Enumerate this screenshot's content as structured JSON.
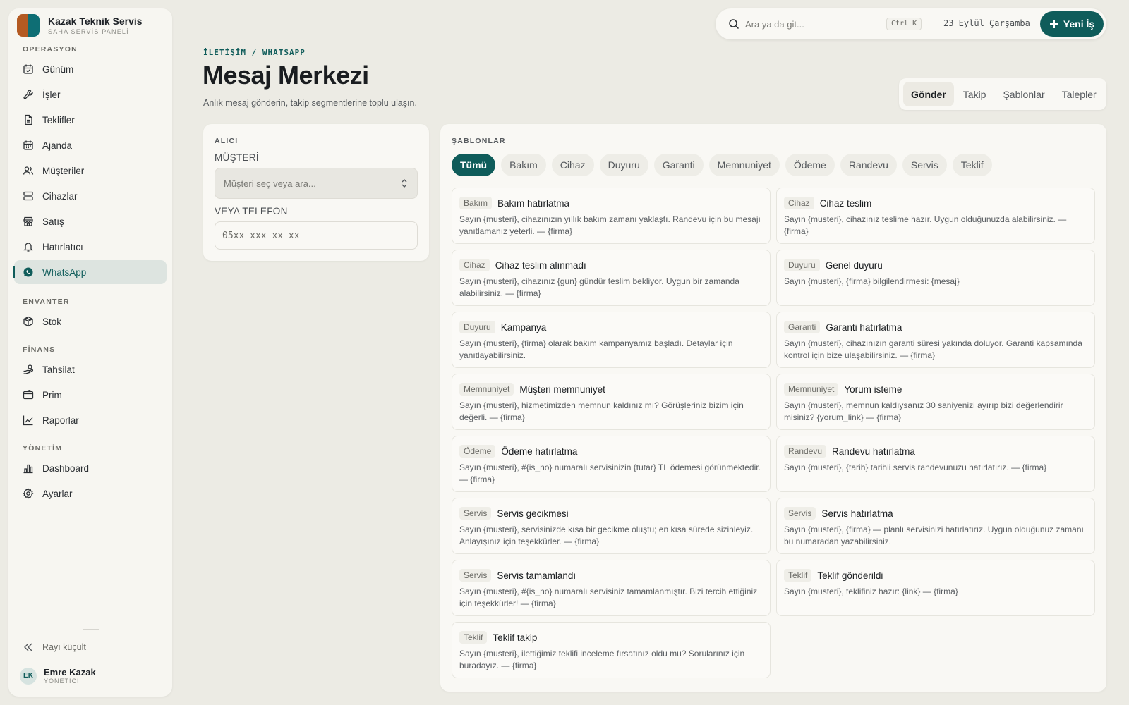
{
  "brand": {
    "title": "Kazak Teknik Servis",
    "subtitle": "SAHA SERVİS PANELİ",
    "logo_colors": [
      "#b45a22",
      "#0e6e74"
    ]
  },
  "sidebar": {
    "sections": [
      {
        "label": "OPERASYON",
        "items": [
          {
            "label": "Günüm",
            "icon": "calendar-check-icon"
          },
          {
            "label": "İşler",
            "icon": "wrench-icon"
          },
          {
            "label": "Teklifler",
            "icon": "document-icon"
          },
          {
            "label": "Ajanda",
            "icon": "calendar-icon"
          },
          {
            "label": "Müşteriler",
            "icon": "users-icon"
          },
          {
            "label": "Cihazlar",
            "icon": "server-icon"
          },
          {
            "label": "Satış",
            "icon": "store-icon"
          },
          {
            "label": "Hatırlatıcı",
            "icon": "bell-icon"
          },
          {
            "label": "WhatsApp",
            "icon": "whatsapp-icon",
            "active": true
          }
        ]
      },
      {
        "label": "ENVANTER",
        "items": [
          {
            "label": "Stok",
            "icon": "box-icon"
          }
        ]
      },
      {
        "label": "FİNANS",
        "items": [
          {
            "label": "Tahsilat",
            "icon": "hand-coins-icon"
          },
          {
            "label": "Prim",
            "icon": "wallet-icon"
          },
          {
            "label": "Raporlar",
            "icon": "trend-chart-icon"
          }
        ]
      },
      {
        "label": "YÖNETİM",
        "items": [
          {
            "label": "Dashboard",
            "icon": "bar-chart-icon"
          },
          {
            "label": "Ayarlar",
            "icon": "gear-icon"
          }
        ]
      }
    ],
    "collapse_label": "Rayı küçült",
    "user": {
      "initials": "EK",
      "name": "Emre Kazak",
      "role": "YÖNETİCİ"
    }
  },
  "topbar": {
    "search_placeholder": "Ara ya da git...",
    "shortcut": "Ctrl K",
    "date": "23 Eylül Çarşamba",
    "new_button": "Yeni İş"
  },
  "header": {
    "breadcrumb": "İLETİŞİM / WHATSAPP",
    "title": "Mesaj Merkezi",
    "subtitle": "Anlık mesaj gönderin, takip segmentlerine toplu ulaşın."
  },
  "tabs": [
    {
      "label": "Gönder",
      "active": true
    },
    {
      "label": "Takip"
    },
    {
      "label": "Şablonlar"
    },
    {
      "label": "Talepler"
    }
  ],
  "recipient": {
    "label": "ALICI",
    "customer_label": "MÜŞTERİ",
    "customer_placeholder": "Müşteri seç veya ara...",
    "phone_label": "VEYA TELEFON",
    "phone_placeholder": "05xx xxx xx xx"
  },
  "templates": {
    "label": "ŞABLONLAR",
    "filters": [
      "Tümü",
      "Bakım",
      "Cihaz",
      "Duyuru",
      "Garanti",
      "Memnuniyet",
      "Ödeme",
      "Randevu",
      "Servis",
      "Teklif"
    ],
    "active_filter": "Tümü",
    "items": [
      {
        "tag": "Bakım",
        "title": "Bakım hatırlatma",
        "body": "Sayın {musteri}, cihazınızın yıllık bakım zamanı yaklaştı. Randevu için bu mesajı yanıtlamanız yeterli. — {firma}"
      },
      {
        "tag": "Cihaz",
        "title": "Cihaz teslim",
        "body": "Sayın {musteri}, cihazınız teslime hazır. Uygun olduğunuzda alabilirsiniz. — {firma}"
      },
      {
        "tag": "Cihaz",
        "title": "Cihaz teslim alınmadı",
        "body": "Sayın {musteri}, cihazınız {gun} gündür teslim bekliyor. Uygun bir zamanda alabilirsiniz. — {firma}"
      },
      {
        "tag": "Duyuru",
        "title": "Genel duyuru",
        "body": "Sayın {musteri}, {firma} bilgilendirmesi: {mesaj}"
      },
      {
        "tag": "Duyuru",
        "title": "Kampanya",
        "body": "Sayın {musteri}, {firma} olarak bakım kampanyamız başladı. Detaylar için yanıtlayabilirsiniz."
      },
      {
        "tag": "Garanti",
        "title": "Garanti hatırlatma",
        "body": "Sayın {musteri}, cihazınızın garanti süresi yakında doluyor. Garanti kapsamında kontrol için bize ulaşabilirsiniz. — {firma}"
      },
      {
        "tag": "Memnuniyet",
        "title": "Müşteri memnuniyet",
        "body": "Sayın {musteri}, hizmetimizden memnun kaldınız mı? Görüşleriniz bizim için değerli. — {firma}"
      },
      {
        "tag": "Memnuniyet",
        "title": "Yorum isteme",
        "body": "Sayın {musteri}, memnun kaldıysanız 30 saniyenizi ayırıp bizi değerlendirir misiniz? {yorum_link} — {firma}"
      },
      {
        "tag": "Ödeme",
        "title": "Ödeme hatırlatma",
        "body": "Sayın {musteri}, #{is_no} numaralı servisinizin {tutar} TL ödemesi görünmektedir. — {firma}"
      },
      {
        "tag": "Randevu",
        "title": "Randevu hatırlatma",
        "body": "Sayın {musteri}, {tarih} tarihli servis randevunuzu hatırlatırız. — {firma}"
      },
      {
        "tag": "Servis",
        "title": "Servis gecikmesi",
        "body": "Sayın {musteri}, servisinizde kısa bir gecikme oluştu; en kısa sürede sizinleyiz. Anlayışınız için teşekkürler. — {firma}"
      },
      {
        "tag": "Servis",
        "title": "Servis hatırlatma",
        "body": "Sayın {musteri}, {firma} — planlı servisinizi hatırlatırız. Uygun olduğunuz zamanı bu numaradan yazabilirsiniz."
      },
      {
        "tag": "Servis",
        "title": "Servis tamamlandı",
        "body": "Sayın {musteri}, #{is_no} numaralı servisiniz tamamlanmıştır. Bizi tercih ettiğiniz için teşekkürler! — {firma}"
      },
      {
        "tag": "Teklif",
        "title": "Teklif gönderildi",
        "body": "Sayın {musteri}, teklifiniz hazır: {link} — {firma}"
      },
      {
        "tag": "Teklif",
        "title": "Teklif takip",
        "body": "Sayın {musteri}, ilettiğimiz teklifi inceleme fırsatınız oldu mu? Sorularınız için buradayız. — {firma}"
      }
    ]
  },
  "colors": {
    "accent": "#0f5c5a",
    "background": "#ecebe4",
    "surface": "#f9f8f4"
  }
}
